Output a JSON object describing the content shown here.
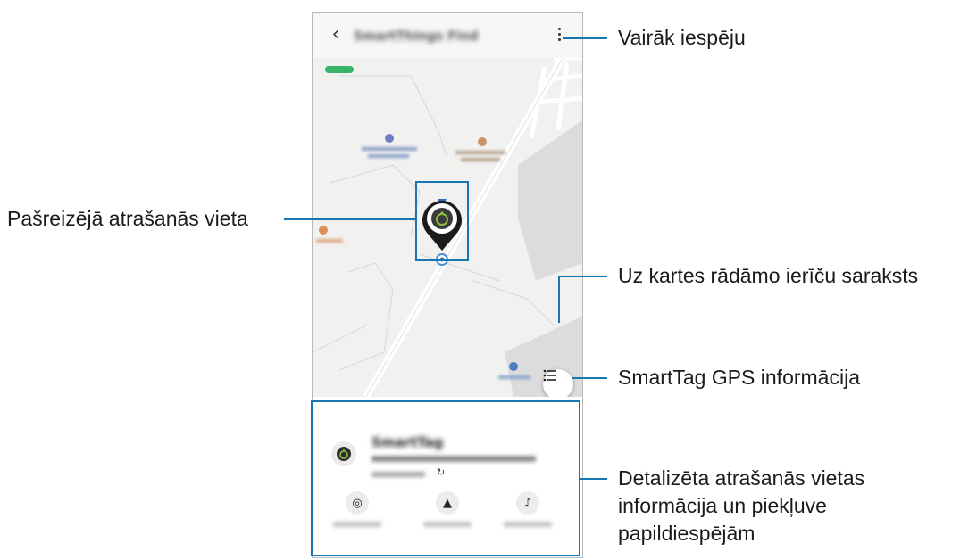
{
  "app": {
    "title": "SmartThings Find"
  },
  "device": {
    "name": "SmartTag"
  },
  "actions": [
    {
      "icon": "search-nearby-icon",
      "glyph": "◎"
    },
    {
      "icon": "navigate-icon",
      "glyph": "▲"
    },
    {
      "icon": "ring-icon",
      "glyph": "♪"
    }
  ],
  "callouts": {
    "more_options": "Vairāk iespēju",
    "current_location": "Pašreizējā atrašanās vieta",
    "device_list": "Uz kartes rādāmo ierīču saraksts",
    "gps_info": "SmartTag GPS informācija",
    "details_line1": "Detalizēta atrašanās vietas",
    "details_line2": "informācija un piekļuve",
    "details_line3": "papildiespējām"
  },
  "colors": {
    "callout_accent": "#1976b4",
    "location_pin": "#1a1a1a",
    "map_background": "#f1f1f0"
  }
}
